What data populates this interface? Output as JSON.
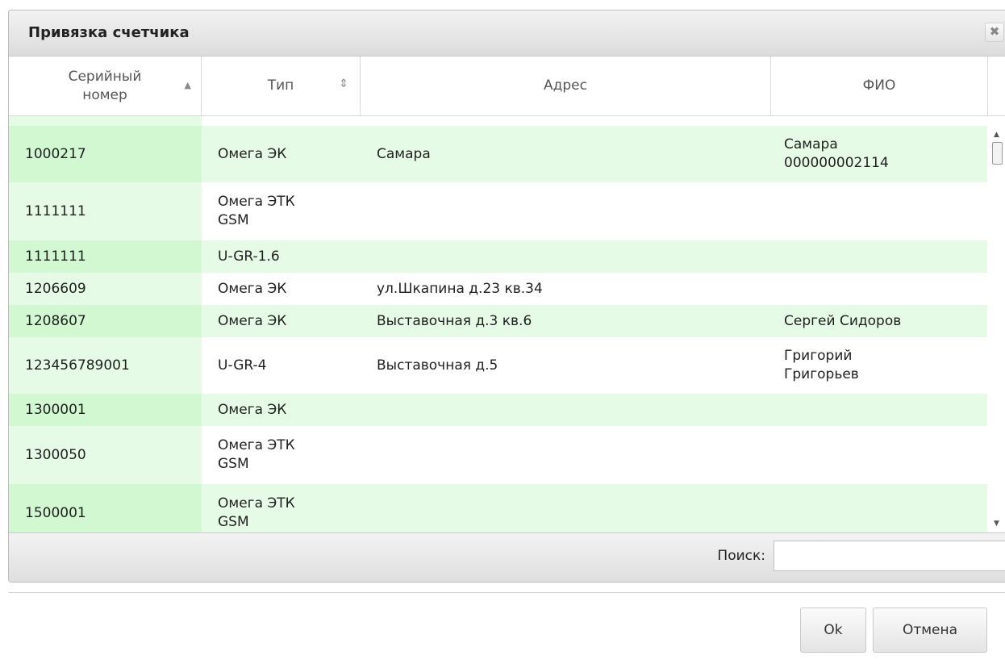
{
  "dialog": {
    "title": "Привязка счетчика",
    "close_glyph": "✖"
  },
  "table": {
    "columns": [
      {
        "label": "Серийный номер",
        "sort_icon": "sort-asc-icon",
        "sort_glyph": "▲"
      },
      {
        "label": "Тип",
        "sort_icon": "sort-both-icon",
        "sort_glyph": "⇕"
      },
      {
        "label": "Адрес"
      },
      {
        "label": "ФИО"
      }
    ],
    "rows": [
      {
        "serial": "1000217",
        "type": "Омега ЭК",
        "address": "Самара",
        "name": "Самара 000000002114"
      },
      {
        "serial": "1111111",
        "type": "Омега ЭТК GSM",
        "address": "",
        "name": ""
      },
      {
        "serial": "1111111",
        "type": "U-GR-1.6",
        "address": "",
        "name": ""
      },
      {
        "serial": "1206609",
        "type": "Омега ЭК",
        "address": "ул.Шкапина д.23 кв.34",
        "name": ""
      },
      {
        "serial": "1208607",
        "type": "Омега ЭК",
        "address": "Выставочная д.3 кв.6",
        "name": "Сергей Сидоров"
      },
      {
        "serial": "123456789001",
        "type": "U-GR-4",
        "address": "Выставочная д.5",
        "name": "Григорий Григорьев"
      },
      {
        "serial": "1300001",
        "type": "Омега ЭК",
        "address": "",
        "name": ""
      },
      {
        "serial": "1300050",
        "type": "Омега ЭТК GSM",
        "address": "",
        "name": ""
      },
      {
        "serial": "1500001",
        "type": "Омега ЭТК GSM",
        "address": "",
        "name": ""
      }
    ]
  },
  "search": {
    "label": "Поиск:",
    "value": "",
    "placeholder": ""
  },
  "buttons": {
    "ok": "Ok",
    "cancel": "Отмена"
  },
  "colors": {
    "row_even": "#e6fbe6",
    "serial_column": "#d1f8d1"
  }
}
